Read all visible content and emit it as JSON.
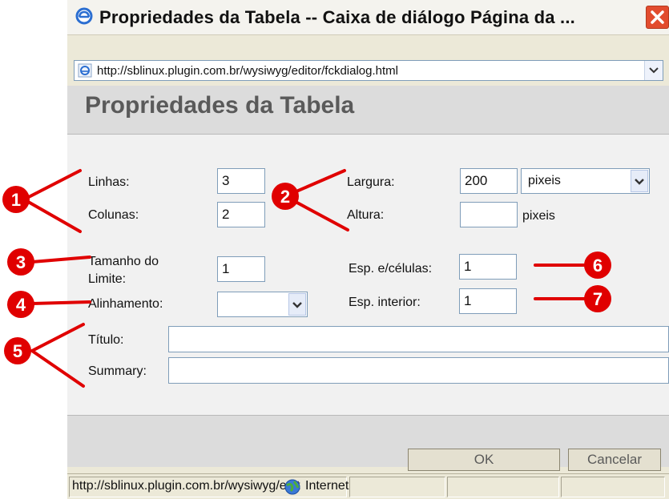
{
  "window": {
    "title": "Propriedades da Tabela -- Caixa de diálogo Página da ...",
    "address": "http://sblinux.plugin.com.br/wysiwyg/editor/fckdialog.html"
  },
  "dialog": {
    "header": "Propriedades da Tabela",
    "rows_label": "Linhas:",
    "rows_value": "3",
    "cols_label": "Colunas:",
    "cols_value": "2",
    "width_label": "Largura:",
    "width_value": "200",
    "width_unit_selected": "pixeis",
    "height_label": "Altura:",
    "height_value": "",
    "height_unit": "pixeis",
    "border_label_line1": "Tamanho do",
    "border_label_line2": "Limite:",
    "border_value": "1",
    "spacing_label": "Esp. e/células:",
    "spacing_value": "1",
    "align_label": "Alinhamento:",
    "align_value": "",
    "padding_label": "Esp. interior:",
    "padding_value": "1",
    "caption_label": "Título:",
    "caption_value": "",
    "summary_label": "Summary:",
    "summary_value": ""
  },
  "buttons": {
    "ok": "OK",
    "cancel": "Cancelar"
  },
  "status": {
    "url": "http://sblinux.plugin.com.br/wysiwyg/edit",
    "zone": "Internet"
  },
  "annotations": {
    "color": "#e00000",
    "badges": [
      "1",
      "2",
      "3",
      "4",
      "5",
      "6",
      "7"
    ]
  }
}
